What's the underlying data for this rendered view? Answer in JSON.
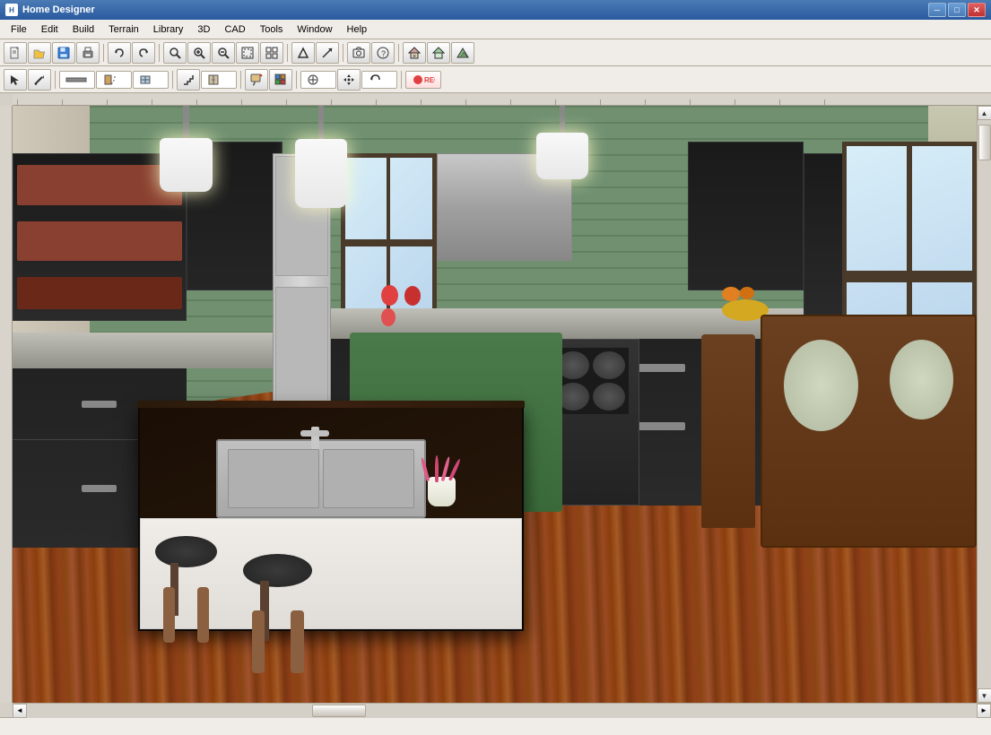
{
  "titleBar": {
    "title": "Home Designer",
    "appIcon": "H",
    "minimizeBtn": "─",
    "maximizeBtn": "□",
    "closeBtn": "✕"
  },
  "menuBar": {
    "items": [
      "File",
      "Edit",
      "Build",
      "Terrain",
      "Library",
      "3D",
      "CAD",
      "Tools",
      "Window",
      "Help"
    ]
  },
  "toolbar1": {
    "buttons": [
      {
        "name": "new",
        "icon": "📄"
      },
      {
        "name": "open",
        "icon": "📂"
      },
      {
        "name": "save",
        "icon": "💾"
      },
      {
        "name": "print",
        "icon": "🖨"
      },
      {
        "name": "undo",
        "icon": "↩"
      },
      {
        "name": "redo",
        "icon": "↪"
      },
      {
        "name": "zoom-in-glass",
        "icon": "🔍"
      },
      {
        "name": "zoom-in",
        "icon": "+"
      },
      {
        "name": "zoom-out",
        "icon": "−"
      },
      {
        "name": "fit",
        "icon": "⊡"
      },
      {
        "name": "fit2",
        "icon": "⊞"
      },
      {
        "name": "arrow-up",
        "icon": "↑"
      },
      {
        "name": "arrow-diag",
        "icon": "↗"
      },
      {
        "name": "camera",
        "icon": "📷"
      },
      {
        "name": "help",
        "icon": "?"
      },
      {
        "name": "house",
        "icon": "🏠"
      },
      {
        "name": "roof",
        "icon": "⌂"
      },
      {
        "name": "terrain",
        "icon": "⛰"
      }
    ]
  },
  "toolbar2": {
    "buttons": [
      {
        "name": "select",
        "icon": "↖"
      },
      {
        "name": "draw",
        "icon": "✏"
      },
      {
        "name": "wall",
        "icon": "⊞"
      },
      {
        "name": "door",
        "icon": "▭"
      },
      {
        "name": "window",
        "icon": "⊟"
      },
      {
        "name": "stairs",
        "icon": "≡"
      },
      {
        "name": "cabinet",
        "icon": "▬"
      },
      {
        "name": "paint",
        "icon": "🖌"
      },
      {
        "name": "material",
        "icon": "◈"
      },
      {
        "name": "place",
        "icon": "⊕"
      },
      {
        "name": "move",
        "icon": "✦"
      },
      {
        "name": "rotate",
        "icon": "↻"
      },
      {
        "name": "record",
        "icon": "⏺"
      }
    ]
  },
  "viewport": {
    "scene": "3D Kitchen View"
  },
  "statusBar": {
    "text": ""
  },
  "scrollbars": {
    "upArrow": "▲",
    "downArrow": "▼",
    "leftArrow": "◄",
    "rightArrow": "►"
  }
}
